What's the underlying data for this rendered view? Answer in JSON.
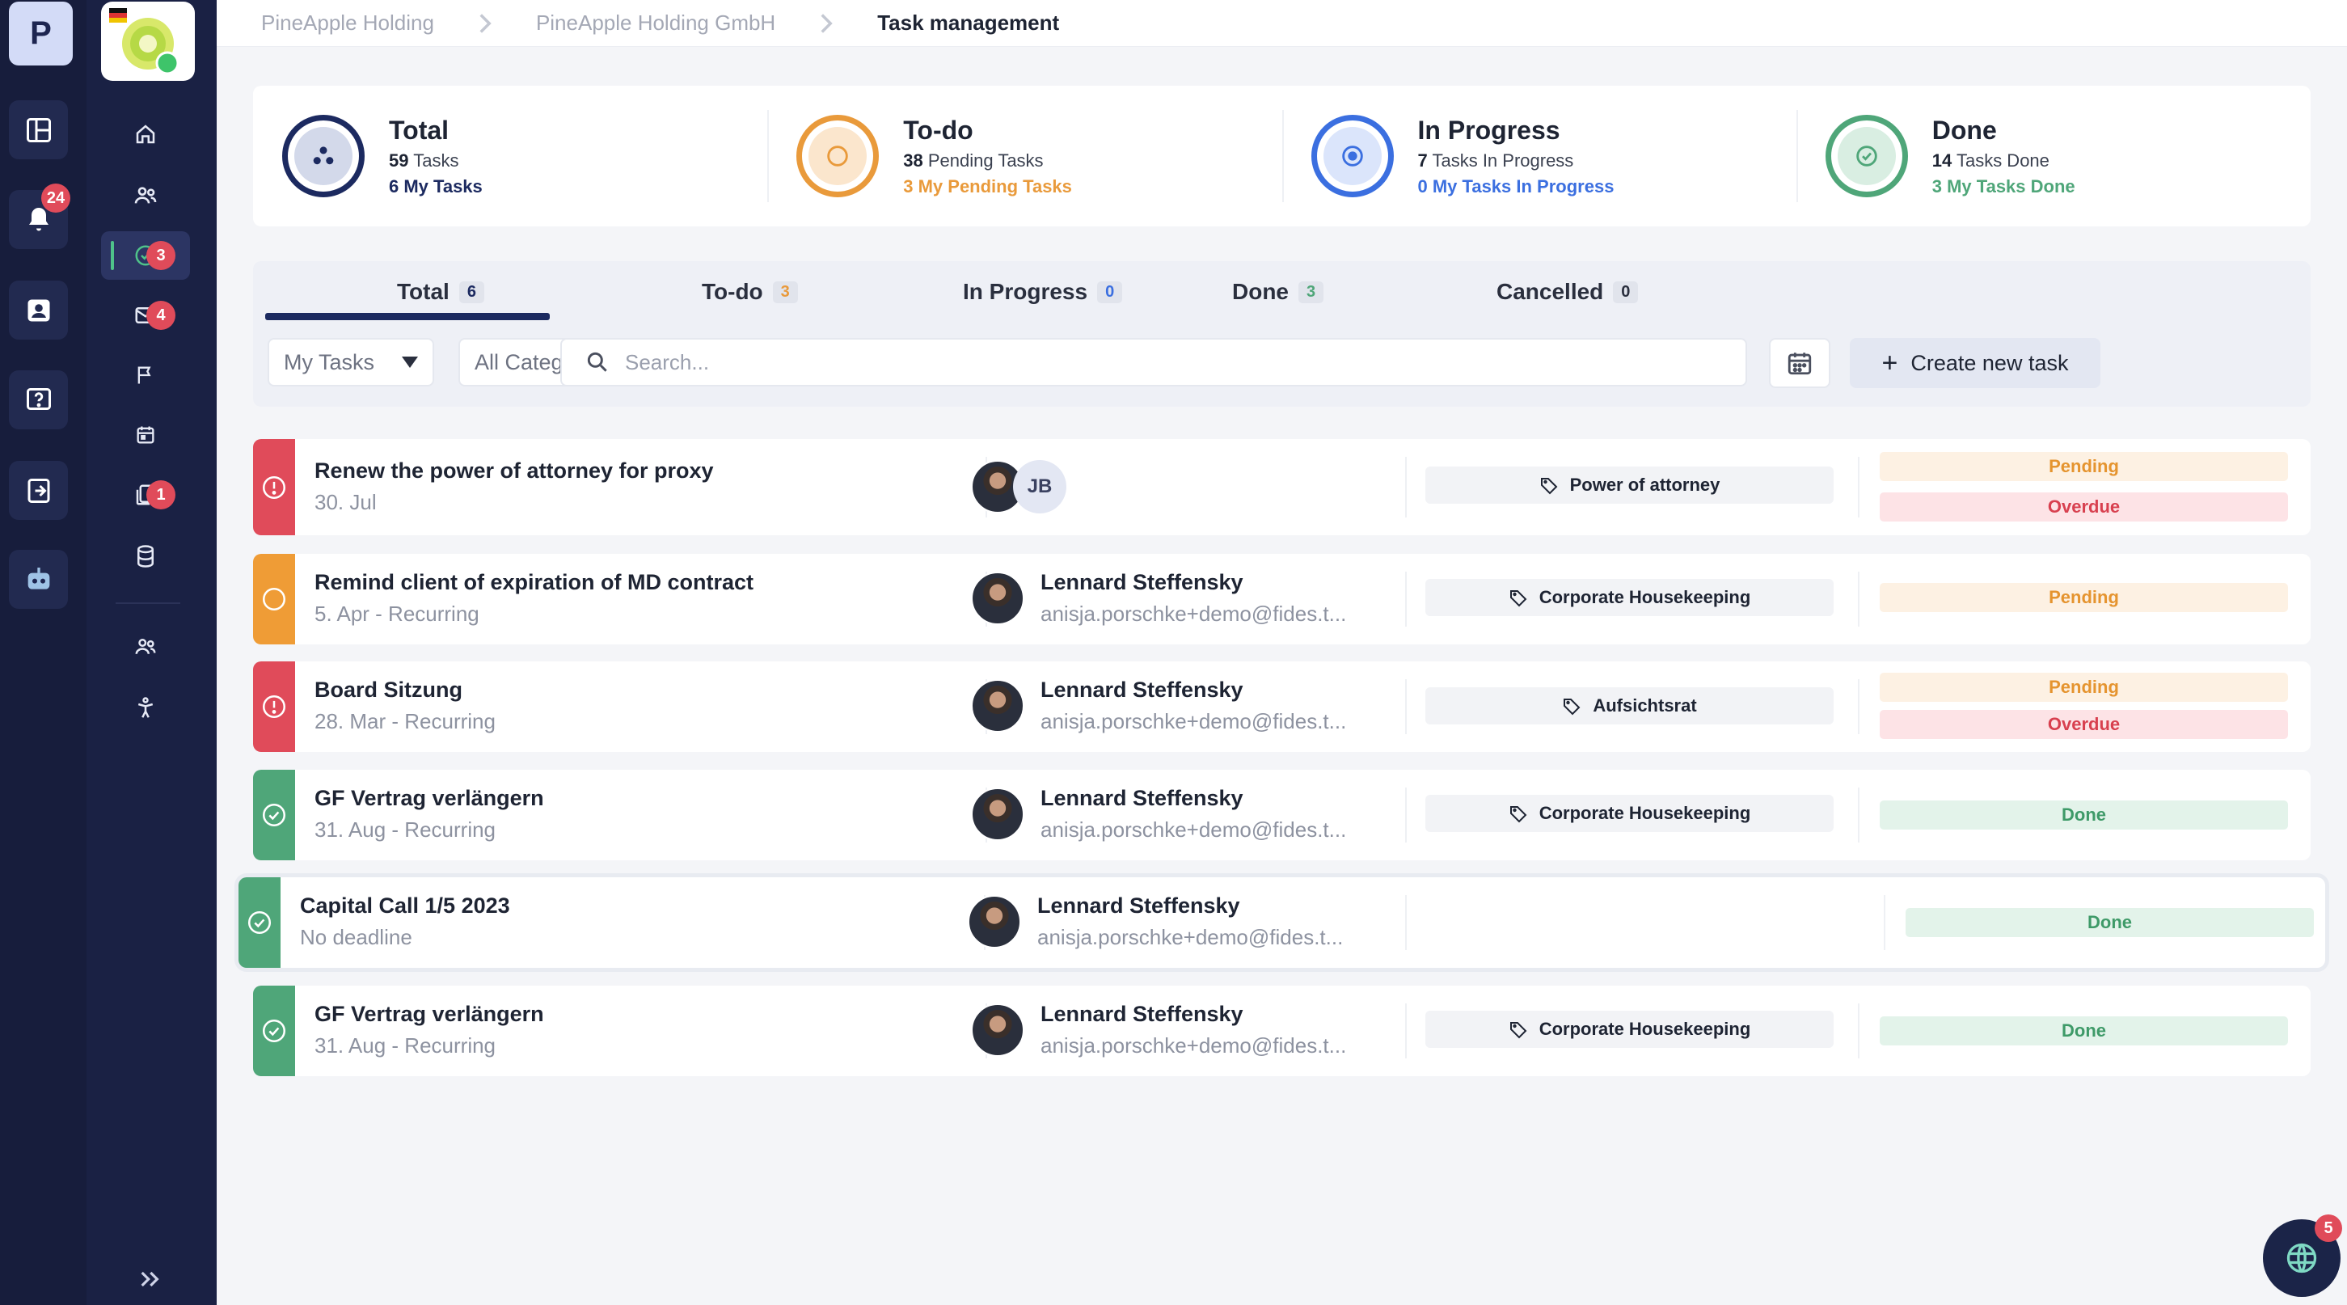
{
  "rail": {
    "logo_letter": "P",
    "notifications_badge": "24"
  },
  "nav": {
    "tasks_badge": "3",
    "inbox_badge": "4",
    "documents_badge": "1"
  },
  "breadcrumb": [
    "PineApple Holding",
    "PineApple Holding GmbH",
    "Task management"
  ],
  "stats": [
    {
      "title": "Total",
      "count": "59",
      "line1": "Tasks",
      "line2": "6 My Tasks",
      "color": "#1c2a60"
    },
    {
      "title": "To-do",
      "count": "38",
      "line1": "Pending Tasks",
      "line2": "3 My Pending Tasks",
      "color": "#e99a3b"
    },
    {
      "title": "In Progress",
      "count": "7",
      "line1": "Tasks In Progress",
      "line2": "0 My Tasks In Progress",
      "color": "#3b6fe0"
    },
    {
      "title": "Done",
      "count": "14",
      "line1": "Tasks Done",
      "line2": "3 My Tasks Done",
      "color": "#4fa679"
    }
  ],
  "tabs": [
    {
      "label": "Total",
      "count": "6"
    },
    {
      "label": "To-do",
      "count": "3"
    },
    {
      "label": "In Progress",
      "count": "0"
    },
    {
      "label": "Done",
      "count": "3"
    },
    {
      "label": "Cancelled",
      "count": "0"
    }
  ],
  "filters": {
    "assignee": "My Tasks",
    "category": "All Categories",
    "search_placeholder": "Search...",
    "create_label": "Create new task"
  },
  "tasks": [
    {
      "title": "Renew the power of attorney for proxy",
      "date": "30. Jul",
      "initials": "JB",
      "category": "Power of attorney",
      "status": [
        "Pending",
        "Overdue"
      ],
      "state": "overdue"
    },
    {
      "title": "Remind client of expiration of MD contract",
      "date": "5. Apr - Recurring",
      "assignee": "Lennard Steffensky",
      "email": "anisja.porschke+demo@fides.t...",
      "category": "Corporate Housekeeping",
      "status": [
        "Pending"
      ],
      "state": "todo"
    },
    {
      "title": "Board Sitzung",
      "date": "28. Mar - Recurring",
      "assignee": "Lennard Steffensky",
      "email": "anisja.porschke+demo@fides.t...",
      "category": "Aufsichtsrat",
      "status": [
        "Pending",
        "Overdue"
      ],
      "state": "overdue"
    },
    {
      "title": "GF Vertrag verlängern",
      "date": "31. Aug - Recurring",
      "assignee": "Lennard Steffensky",
      "email": "anisja.porschke+demo@fides.t...",
      "category": "Corporate Housekeeping",
      "status": [
        "Done"
      ],
      "state": "done"
    },
    {
      "title": "Capital Call 1/5 2023",
      "date": "No deadline",
      "assignee": "Lennard Steffensky",
      "email": "anisja.porschke+demo@fides.t...",
      "category": "",
      "status": [
        "Done"
      ],
      "state": "done"
    },
    {
      "title": "GF Vertrag verlängern",
      "date": "31. Aug - Recurring",
      "assignee": "Lennard Steffensky",
      "email": "anisja.porschke+demo@fides.t...",
      "category": "Corporate Housekeeping",
      "status": [
        "Done"
      ],
      "state": "done"
    }
  ],
  "help_badge": "5",
  "colors": {
    "overdue": "#e04b5a",
    "todo": "#ef9c36",
    "done": "#4fa679",
    "navy": "#1c2a60"
  }
}
